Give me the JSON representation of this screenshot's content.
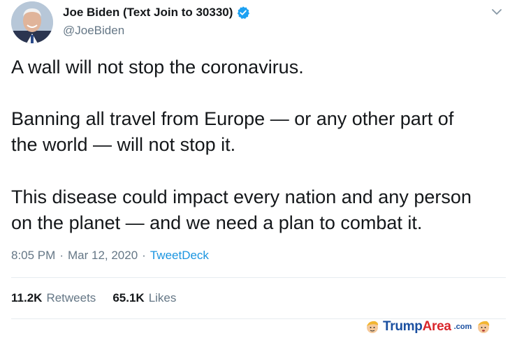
{
  "tweet": {
    "display_name": "Joe Biden (Text Join to 30330)",
    "handle": "@JoeBiden",
    "paragraphs": [
      [
        "A wall will not stop the coronavirus."
      ],
      [
        "Banning all travel from Europe — or any other part of",
        "the world — will not stop it."
      ],
      [
        "This disease could impact every nation and any person",
        "on the planet — and we need a plan to combat it."
      ]
    ],
    "time": "8:05 PM",
    "date": "Mar 12, 2020",
    "source": "TweetDeck",
    "separator": "·",
    "stats": {
      "retweets_count": "11.2K",
      "retweets_label": "Retweets",
      "likes_count": "65.1K",
      "likes_label": "Likes"
    },
    "icons": {
      "verified": "verified-badge-icon",
      "caret": "chevron-down-icon"
    },
    "colors": {
      "verified": "#1da1f2",
      "link": "#1b95e0",
      "secondary_text": "#657786",
      "divider": "#e6ecf0"
    }
  },
  "watermark": {
    "brand_part1": "Trump",
    "brand_part2": "Area",
    "suffix": ".com"
  }
}
